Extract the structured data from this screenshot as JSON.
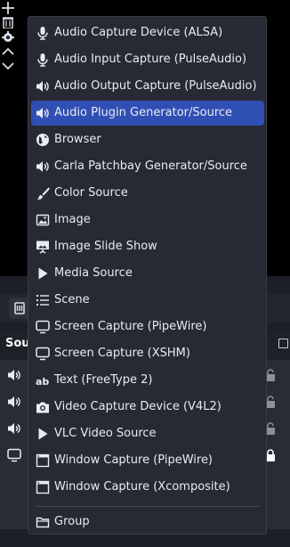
{
  "menu": {
    "items": [
      {
        "label": "Audio Capture Device (ALSA)",
        "icon": "microphone-icon"
      },
      {
        "label": "Audio Input Capture (PulseAudio)",
        "icon": "microphone-icon"
      },
      {
        "label": "Audio Output Capture (PulseAudio)",
        "icon": "speaker-icon"
      },
      {
        "label": "Audio Plugin Generator/Source",
        "icon": "speaker-icon",
        "selected": true
      },
      {
        "label": "Browser",
        "icon": "globe-icon"
      },
      {
        "label": "Carla Patchbay Generator/Source",
        "icon": "speaker-icon"
      },
      {
        "label": "Color Source",
        "icon": "paint-brush-icon"
      },
      {
        "label": "Image",
        "icon": "image-icon"
      },
      {
        "label": "Image Slide Show",
        "icon": "slideshow-icon"
      },
      {
        "label": "Media Source",
        "icon": "play-icon"
      },
      {
        "label": "Scene",
        "icon": "list-icon"
      },
      {
        "label": "Screen Capture (PipeWire)",
        "icon": "monitor-icon"
      },
      {
        "label": "Screen Capture (XSHM)",
        "icon": "monitor-icon"
      },
      {
        "label": "Text (FreeType 2)",
        "icon": "text-icon"
      },
      {
        "label": "Video Capture Device (V4L2)",
        "icon": "camera-icon"
      },
      {
        "label": "VLC Video Source",
        "icon": "play-icon"
      },
      {
        "label": "Window Capture (PipeWire)",
        "icon": "window-icon"
      },
      {
        "label": "Window Capture (Xcomposite)",
        "icon": "window-icon"
      }
    ],
    "group": {
      "label": "Group",
      "icon": "folder-icon"
    }
  },
  "sources_dock": {
    "title": "Sou",
    "rows": [
      {
        "icon": "speaker-icon",
        "locked": false
      },
      {
        "icon": "speaker-icon",
        "locked": false
      },
      {
        "icon": "speaker-icon",
        "locked": false
      },
      {
        "icon": "monitor-icon",
        "locked": true
      }
    ],
    "toolbar": [
      "add-icon",
      "remove-icon",
      "gear-icon",
      "chevron-up-icon",
      "chevron-down-icon"
    ]
  },
  "colors": {
    "menu_bg": "#272a33",
    "selected_bg": "#2f4fb4",
    "text": "#e9ebf0",
    "dock_bg": "#2a2c35"
  }
}
